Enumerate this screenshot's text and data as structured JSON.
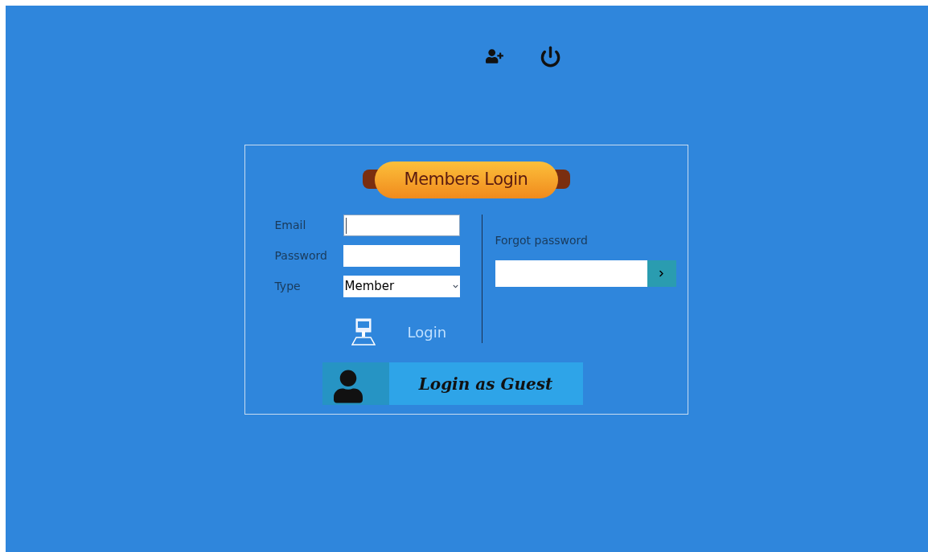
{
  "banner": {
    "title": "Members Login"
  },
  "fields": [
    {
      "label": "Email",
      "kind": "text",
      "focused": true
    },
    {
      "label": "Password",
      "kind": "password",
      "focused": false
    },
    {
      "label": "Type",
      "kind": "select",
      "value": "Member"
    }
  ],
  "login_button": {
    "label": "Login"
  },
  "forgot_password": {
    "label": "Forgot password"
  },
  "guest_button": {
    "label": "Login as Guest"
  }
}
